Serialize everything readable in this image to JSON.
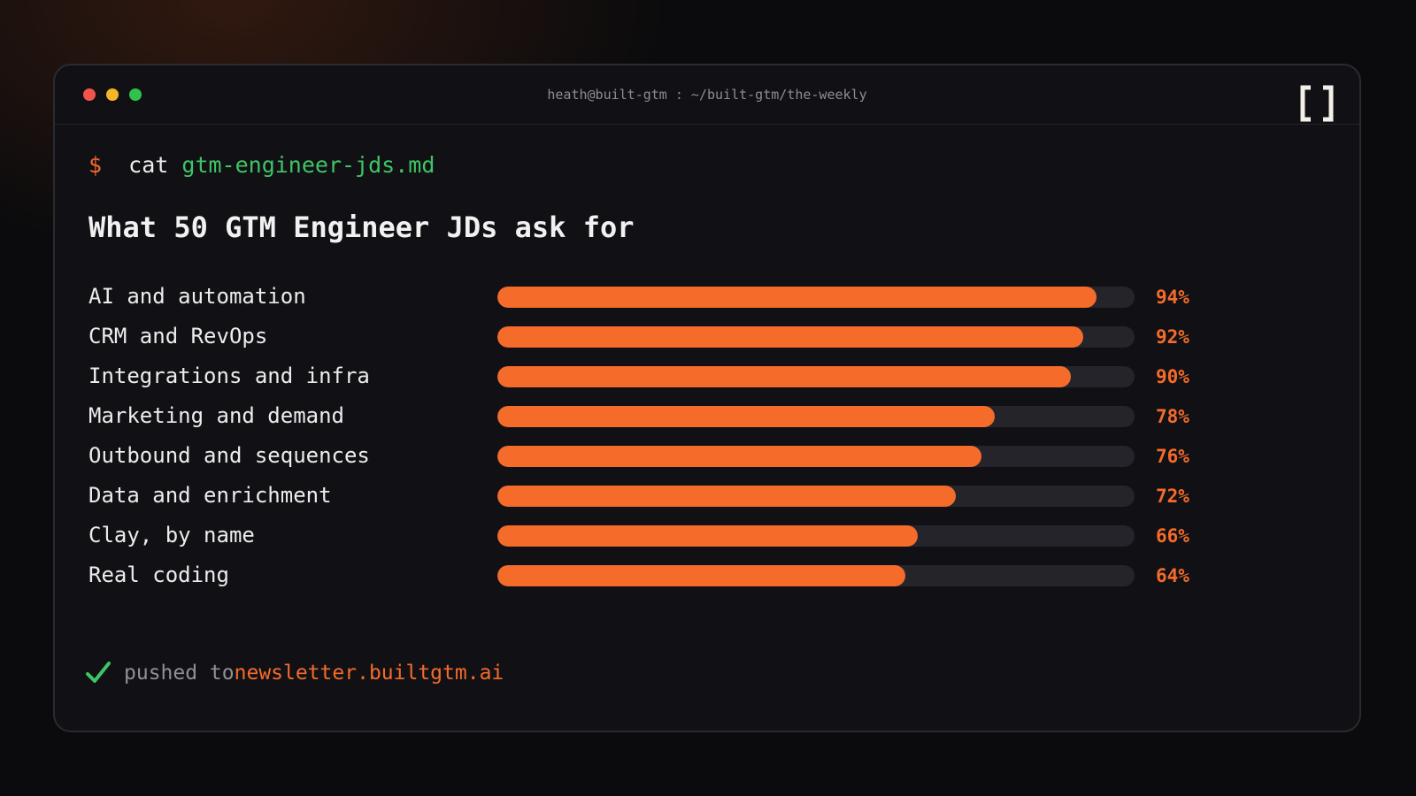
{
  "window": {
    "title": "heath@built-gtm : ~/built-gtm/the-weekly",
    "brand_icon": "bracket-logo-icon"
  },
  "prompt": {
    "symbol": "$",
    "command": "cat",
    "filename": "gtm-engineer-jds.md"
  },
  "chart_data": {
    "type": "bar",
    "orientation": "horizontal",
    "title": "What 50 GTM Engineer JDs ask for",
    "categories": [
      "AI and automation",
      "CRM and RevOps",
      "Integrations and infra",
      "Marketing and demand",
      "Outbound and sequences",
      "Data and enrichment",
      "Clay, by name",
      "Real coding"
    ],
    "values": [
      94,
      92,
      90,
      78,
      76,
      72,
      66,
      64
    ],
    "value_labels": [
      "94%",
      "92%",
      "90%",
      "78%",
      "76%",
      "72%",
      "66%",
      "64%"
    ],
    "xlim": [
      0,
      100
    ],
    "grid": false,
    "legend": "none",
    "bar_color": "#f46b2a",
    "track_color": "#24242a"
  },
  "footer": {
    "icon": "check-icon",
    "text": "pushed to",
    "link": "newsletter.builtgtm.ai"
  },
  "colors": {
    "accent": "#f46b2a",
    "success": "#3fc465",
    "background": "#111115"
  }
}
